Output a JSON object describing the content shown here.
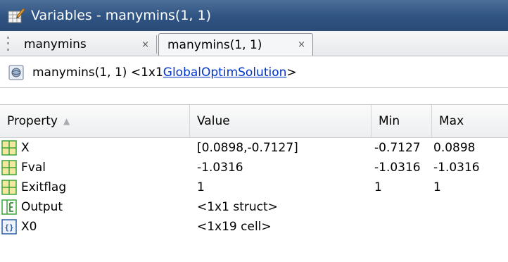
{
  "window": {
    "title": "Variables - manymins(1, 1)"
  },
  "tabs": [
    {
      "label": "manymins",
      "close": "×",
      "active": false
    },
    {
      "label": "manymins(1, 1)",
      "close": "×",
      "active": true
    }
  ],
  "breadcrumb": {
    "prefix": "manymins(1, 1) <1x1 ",
    "link": "GlobalOptimSolution",
    "suffix": ">"
  },
  "table": {
    "columns": [
      "Property",
      "Value",
      "Min",
      "Max"
    ],
    "sort_indicator": "▲",
    "rows": [
      {
        "icon": "matrix-icon",
        "property": "X",
        "value": "[0.0898,-0.7127]",
        "min": "-0.7127",
        "max": "0.0898"
      },
      {
        "icon": "matrix-icon",
        "property": "Fval",
        "value": "-1.0316",
        "min": "-1.0316",
        "max": "-1.0316"
      },
      {
        "icon": "matrix-icon",
        "property": "Exitflag",
        "value": "1",
        "min": "1",
        "max": "1"
      },
      {
        "icon": "struct-icon",
        "property": "Output",
        "value": "<1x1 struct>",
        "min": "",
        "max": ""
      },
      {
        "icon": "cell-icon",
        "property": "X0",
        "value": "<1x19 cell>",
        "min": "",
        "max": ""
      }
    ]
  },
  "colors": {
    "titlebar": "#2f5382",
    "link": "#0033cc",
    "matrix_icon_fill": "#f5e7a0",
    "matrix_icon_grid": "#3aa63a"
  }
}
